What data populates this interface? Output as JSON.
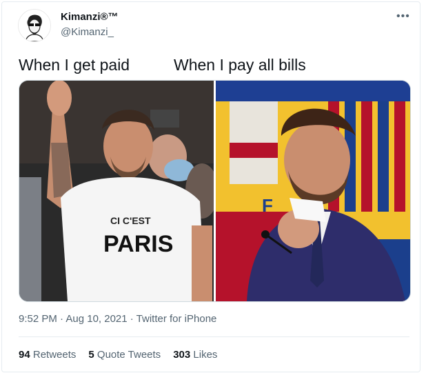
{
  "tweet": {
    "display_name": "Kimanzi®™",
    "handle": "@Kimanzi_",
    "more_icon": "more-horizontal-icon",
    "caption": "When I get paid          When I pay all bills",
    "left_image_shirt_text_top": "CI C'EST",
    "left_image_shirt_text_main": "PARIS",
    "right_image_letter": "F",
    "timestamp": "9:52 PM · Aug 10, 2021 · Twitter for iPhone",
    "retweets_count": "94",
    "retweets_label": "Retweets",
    "quote_count": "5",
    "quote_label": "Quote Tweets",
    "likes_count": "303",
    "likes_label": "Likes"
  },
  "colors": {
    "barca_red": "#b5122b",
    "barca_blue": "#1b3f8c",
    "barca_yellow": "#f2c12e",
    "muted_text": "#536471"
  }
}
